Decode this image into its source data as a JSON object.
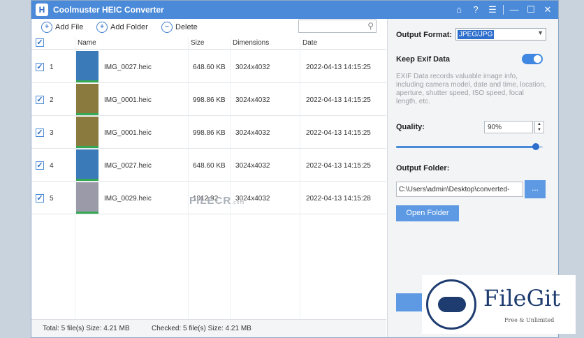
{
  "app": {
    "title": "Coolmuster HEIC Converter",
    "logo_letter": "H"
  },
  "title_buttons": [
    {
      "name": "home-icon",
      "glyph": "⌂"
    },
    {
      "name": "help-icon",
      "glyph": "?"
    },
    {
      "name": "feedback-icon",
      "glyph": "☰"
    },
    {
      "name": "minimize-icon",
      "glyph": "—"
    },
    {
      "name": "maximize-icon",
      "glyph": "☐"
    },
    {
      "name": "close-icon",
      "glyph": "✕"
    }
  ],
  "toolbar": {
    "add_file": "Add File",
    "add_folder": "Add Folder",
    "delete": "Delete"
  },
  "columns": {
    "name": "Name",
    "size": "Size",
    "dimensions": "Dimensions",
    "date": "Date"
  },
  "rows": [
    {
      "index": "1",
      "name": "IMG_0027.heic",
      "size": "648.60 KB",
      "dimensions": "3024x4032",
      "date": "2022-04-13 14:15:25",
      "thumb_color": "#3a7ab8"
    },
    {
      "index": "2",
      "name": "IMG_0001.heic",
      "size": "998.86 KB",
      "dimensions": "3024x4032",
      "date": "2022-04-13 14:15:25",
      "thumb_color": "#8a7a3e"
    },
    {
      "index": "3",
      "name": "IMG_0001.heic",
      "size": "998.86 KB",
      "dimensions": "3024x4032",
      "date": "2022-04-13 14:15:25",
      "thumb_color": "#8a7a3e"
    },
    {
      "index": "4",
      "name": "IMG_0027.heic",
      "size": "648.60 KB",
      "dimensions": "3024x4032",
      "date": "2022-04-13 14:15:25",
      "thumb_color": "#3a7ab8"
    },
    {
      "index": "5",
      "name": "IMG_0029.heic",
      "size": "1012.92",
      "dimensions": "3024x4032",
      "date": "2022-04-13 14:15:28",
      "thumb_color": "#9a9aa8"
    }
  ],
  "status": {
    "total": "Total: 5 file(s) Size: 4.21 MB",
    "checked": "Checked: 5 file(s) Size: 4.21 MB"
  },
  "settings": {
    "output_format_label": "Output Format:",
    "output_format_value": "JPEG/JPG",
    "keep_exif_label": "Keep Exif Data",
    "keep_exif_on": true,
    "exif_description": "EXIF Data records valuable image info, including camera model, date and time, location, aperture, shutter speed, ISO speed, focal length, etc.",
    "quality_label": "Quality:",
    "quality_value": "90%",
    "quality_level": 0.95,
    "output_folder_label": "Output Folder:",
    "output_folder_path": "C:\\Users\\admin\\Desktop\\converted-",
    "browse_label": "...",
    "open_folder_label": "Open Folder"
  },
  "watermarks": {
    "filecr": "FILECR",
    "filecr_suffix": ".com",
    "filegit": "FileGit",
    "filegit_sub": "Free & Unlimited"
  },
  "colors": {
    "accent": "#4a8ad8",
    "button": "#5e9ae4",
    "brand_dark": "#1e3c6f"
  }
}
